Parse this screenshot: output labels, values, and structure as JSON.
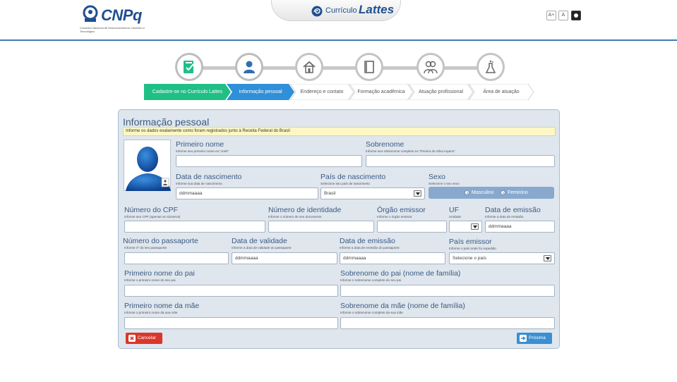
{
  "header": {
    "logo_text": "CNPq",
    "logo_subtitle": "Conselho Nacional de Desenvolvimento Científico e Tecnológico",
    "app_small": "Currículo",
    "app_big": "Lattes",
    "font_increase": "A+",
    "font_reset": "A"
  },
  "steps": [
    {
      "label": "Cadastre-se no Currículo Lattes",
      "icon": "document-check-icon",
      "state": "done"
    },
    {
      "label": "Informação pessoal",
      "icon": "person-icon",
      "state": "current"
    },
    {
      "label": "Endereço e contato",
      "icon": "house-icon",
      "state": "pending"
    },
    {
      "label": "Formação acadêmica",
      "icon": "book-icon",
      "state": "pending"
    },
    {
      "label": "Atuação profissional",
      "icon": "people-icon",
      "state": "pending"
    },
    {
      "label": "Área de atuação",
      "icon": "flask-icon",
      "state": "pending"
    }
  ],
  "form": {
    "title": "Informação pessoal",
    "notice": "Informe os dados exatamente como foram registrados junto à Receita Federal do Brasil",
    "first_name": {
      "label": "Primeiro nome",
      "hint": "Informe seu primeiro nome ex:\"José\"",
      "value": ""
    },
    "surname": {
      "label": "Sobrenome",
      "hint": "Informe seu sobrenome completo ex:\"Pereira da Silva Aquino\"",
      "value": ""
    },
    "birth_date": {
      "label": "Data de nascimento",
      "hint": "Informe sua data de nascimento",
      "placeholder": "ddmmaaaa"
    },
    "birth_country": {
      "label": "País de nascimento",
      "hint": "Selecione seu país de nascimento",
      "value": "Brasil"
    },
    "sex": {
      "label": "Sexo",
      "hint": "Selecione o seu sexo",
      "male": "Masculino",
      "female": "Feminino"
    },
    "cpf": {
      "label": "Número do CPF",
      "hint": "Informe seu CPF (apenas os números)",
      "value": ""
    },
    "id_number": {
      "label": "Número de identidade",
      "hint": "Informe o número de seu documento",
      "value": ""
    },
    "issuer": {
      "label": "Órgão emissor",
      "hint": "Informe o órgão emissor",
      "value": ""
    },
    "uf": {
      "label": "UF",
      "hint": "Unidade",
      "value": ""
    },
    "issue_date": {
      "label": "Data de emissão",
      "hint": "Informe a data de emissão",
      "placeholder": "ddmmaaaa"
    },
    "passport": {
      "label": "Número do passaporte",
      "hint": "Informe nº do seu passaporte",
      "value": ""
    },
    "validity": {
      "label": "Data de validade",
      "hint": "Informe a data de validade do passaporte",
      "placeholder": "ddmmaaaa"
    },
    "passport_issue": {
      "label": "Data de emissão",
      "hint": "Informe a data de emissão do passaporte",
      "placeholder": "ddmmaaaa"
    },
    "issuing_country": {
      "label": "País emissor",
      "hint": "Informe o país onde foi expedido",
      "value": "Selecione o país"
    },
    "father_first": {
      "label": "Primeiro nome do pai",
      "hint": "Informe o primeiro nome do seu pai",
      "value": ""
    },
    "father_surname": {
      "label": "Sobrenome do pai (nome de família)",
      "hint": "Informe o sobrenome completo do seu pai",
      "value": ""
    },
    "mother_first": {
      "label": "Primeiro nome da mãe",
      "hint": "Informe o primeiro nome da sua mãe",
      "value": ""
    },
    "mother_surname": {
      "label": "Sobrenome da mãe (nome de família)",
      "hint": "Informe o sobrenome completo da sua mãe",
      "value": ""
    },
    "cancel": "Cancelar",
    "next": "Próxima"
  },
  "colors": {
    "step_done": "#1fbf86",
    "step_current": "#2f8fd8",
    "panel_bg": "#dfe6ee",
    "title": "#3b5a80",
    "cancel": "#d9372a",
    "next": "#3a8fd1"
  }
}
